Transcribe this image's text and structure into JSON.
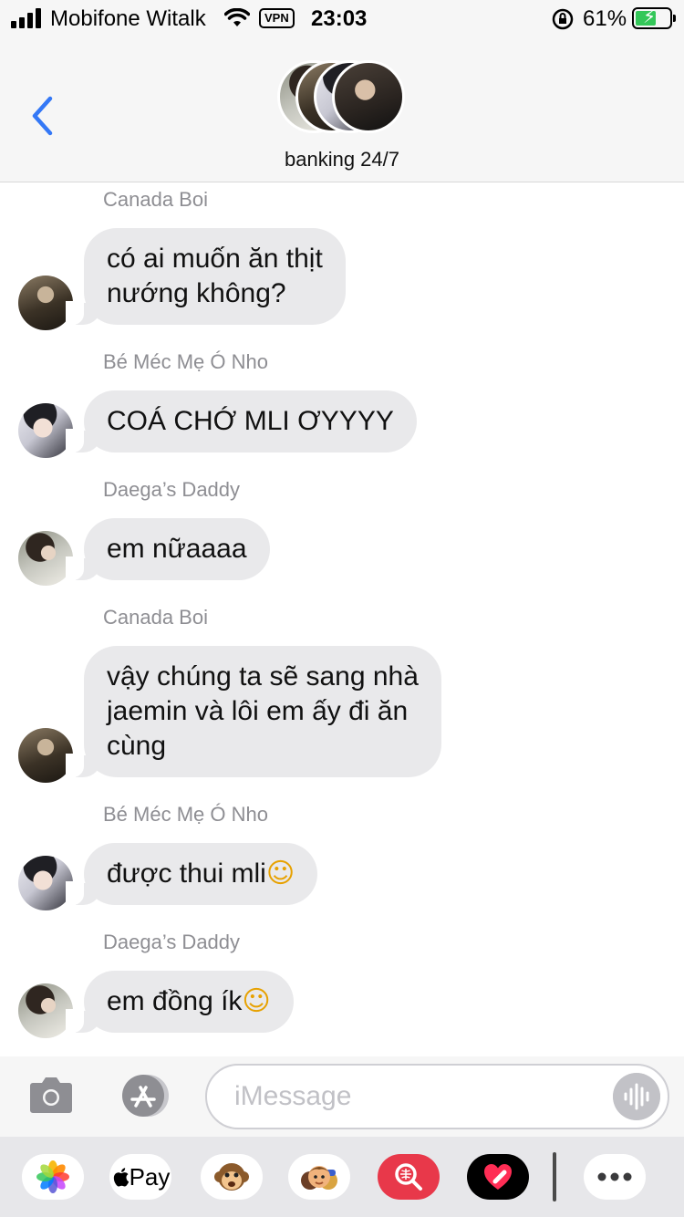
{
  "status_bar": {
    "carrier": "Mobifone Witalk",
    "vpn": "VPN",
    "time": "23:03",
    "battery": "61%",
    "battery_level": 0.61
  },
  "header": {
    "group_name": "banking 24/7"
  },
  "messages": [
    {
      "sender": "Canada Boi",
      "text_lines": [
        "có ai muốn ăn thịt",
        "nướng không?"
      ]
    },
    {
      "sender": "Bé Méc Mẹ Ó Nho",
      "text_lines": [
        "COÁ CHỚ MLI ƠYYYY"
      ]
    },
    {
      "sender": "Daega’s Daddy",
      "text_lines": [
        "em nữaaaa"
      ]
    },
    {
      "sender": "Canada Boi",
      "text_lines": [
        "vậy chúng ta sẽ sang nhà",
        "jaemin và lôi em ấy đi ăn",
        "cùng"
      ]
    },
    {
      "sender": "Bé Méc Mẹ Ó Nho",
      "text": "được thui mli",
      "emoji": "smiling-face-with-hearts"
    },
    {
      "sender": "Daega’s Daddy",
      "text": "em đồng ík",
      "emoji": "smiling-face-with-hearts"
    }
  ],
  "input": {
    "placeholder": "iMessage"
  },
  "drawer": {
    "apple_pay_label": "Pay",
    "icons": [
      "photos-icon",
      "apple-pay-icon",
      "animoji-icon",
      "memoji-icon",
      "image-search-icon",
      "digital-touch-icon",
      "more-icon"
    ]
  },
  "colors": {
    "accent": "#3478f6",
    "bubble": "#e9e9eb",
    "sender_label": "#8e8e93",
    "battery": "#34c759"
  }
}
